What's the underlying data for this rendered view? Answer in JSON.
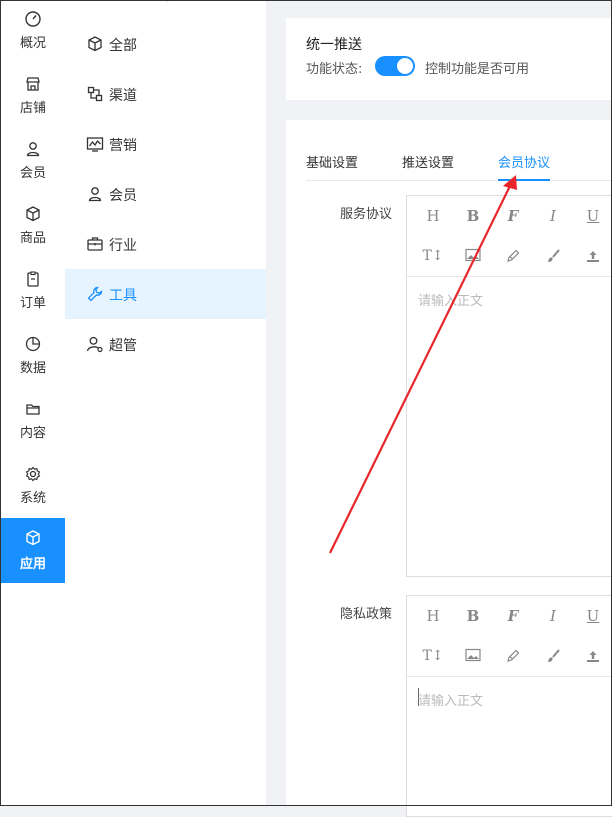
{
  "nav": {
    "items": [
      {
        "label": "概况",
        "icon": "dashboard-icon"
      },
      {
        "label": "店铺",
        "icon": "shop-icon"
      },
      {
        "label": "会员",
        "icon": "user-icon"
      },
      {
        "label": "商品",
        "icon": "box-icon"
      },
      {
        "label": "订单",
        "icon": "clipboard-icon"
      },
      {
        "label": "数据",
        "icon": "pie-icon"
      },
      {
        "label": "内容",
        "icon": "folder-icon"
      },
      {
        "label": "系统",
        "icon": "gear-icon"
      },
      {
        "label": "应用",
        "icon": "cube-icon"
      }
    ],
    "active_label": "应用"
  },
  "submenu": {
    "items": [
      {
        "label": "全部",
        "icon": "cube-icon"
      },
      {
        "label": "渠道",
        "icon": "channel-icon"
      },
      {
        "label": "营销",
        "icon": "chart-icon"
      },
      {
        "label": "会员",
        "icon": "user-icon"
      },
      {
        "label": "行业",
        "icon": "briefcase-icon"
      },
      {
        "label": "工具",
        "icon": "wrench-icon"
      },
      {
        "label": "超管",
        "icon": "admin-icon"
      }
    ],
    "active_label": "工具"
  },
  "header": {
    "title": "统一推送",
    "status_label": "功能状态:",
    "status_on": true,
    "status_desc": "控制功能是否可用"
  },
  "tabs": [
    {
      "label": "基础设置"
    },
    {
      "label": "推送设置"
    },
    {
      "label": "会员协议"
    }
  ],
  "active_tab": "会员协议",
  "fields": [
    {
      "label": "服务协议",
      "placeholder": "请输入正文"
    },
    {
      "label": "隐私政策",
      "placeholder": "请输入正文"
    }
  ],
  "toolbar": {
    "heading": "H",
    "bold": "B",
    "font": "F",
    "italic": "I",
    "underline": "U",
    "font_size": "T↕"
  },
  "colors": {
    "accent": "#1890ff",
    "annotation_arrow": "#e8262b"
  }
}
